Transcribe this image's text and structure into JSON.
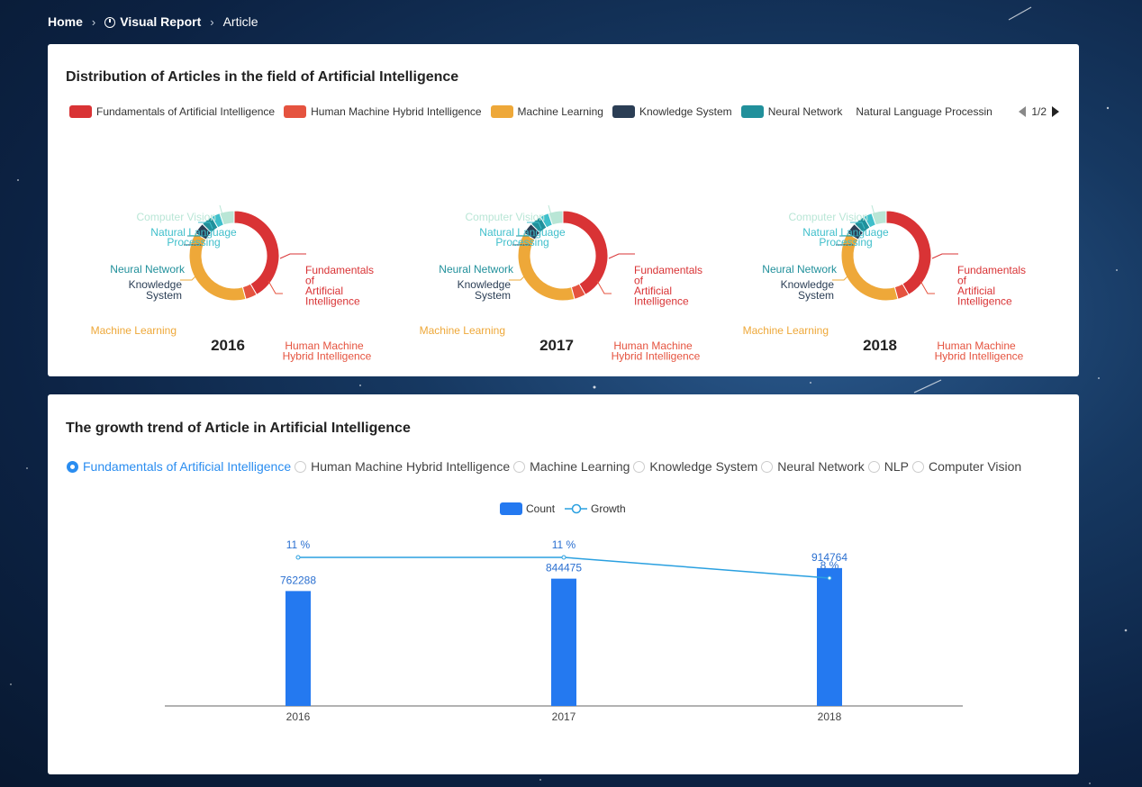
{
  "breadcrumb": {
    "home": "Home",
    "report": "Visual Report",
    "current": "Article"
  },
  "colors": {
    "fundamentals": "#d93335",
    "hmhi": "#e5533f",
    "ml": "#eea839",
    "knowledge": "#2b3e55",
    "neural": "#21909b",
    "nlp": "#3fbfcb",
    "cv": "#b9e6d6",
    "bar": "#2479f0",
    "line": "#2aa0e0"
  },
  "distribution": {
    "title": "Distribution of Articles in the field of Artificial Intelligence",
    "legend": [
      "Fundamentals of Artificial Intelligence",
      "Human Machine Hybrid Intelligence",
      "Machine Learning",
      "Knowledge System",
      "Neural Network",
      "Natural Language Processing"
    ],
    "pager": "1/2",
    "years": [
      "2016",
      "2017",
      "2018"
    ],
    "labels": {
      "cv": "Computer Vision",
      "nlp": [
        "Natural Language",
        "Processing"
      ],
      "neural": "Neural Network",
      "knowledge": [
        "Knowledge",
        "System"
      ],
      "ml": "Machine Learning",
      "fund": [
        "Fundamentals",
        "of",
        "Artificial",
        "Intelligence"
      ],
      "hmhi": [
        "Human Machine",
        "Hybrid Intelligence"
      ]
    }
  },
  "trend": {
    "title": "The growth trend of Article in Artificial Intelligence",
    "options": [
      "Fundamentals of Artificial Intelligence",
      "Human Machine Hybrid Intelligence",
      "Machine Learning",
      "Knowledge System",
      "Neural Network",
      "NLP",
      "Computer Vision"
    ],
    "selected_index": 0,
    "legend_count": "Count",
    "legend_growth": "Growth"
  },
  "chart_data": [
    {
      "type": "pie",
      "title": "2016",
      "categories": [
        "Fundamentals of Artificial Intelligence",
        "Human Machine Hybrid Intelligence",
        "Machine Learning",
        "Knowledge System",
        "Neural Network",
        "Natural Language Processing",
        "Computer Vision"
      ],
      "values": [
        40,
        4,
        36,
        4,
        4,
        3,
        5
      ]
    },
    {
      "type": "pie",
      "title": "2017",
      "categories": [
        "Fundamentals of Artificial Intelligence",
        "Human Machine Hybrid Intelligence",
        "Machine Learning",
        "Knowledge System",
        "Neural Network",
        "Natural Language Processing",
        "Computer Vision"
      ],
      "values": [
        40,
        4,
        36,
        4,
        4,
        3,
        5
      ]
    },
    {
      "type": "pie",
      "title": "2018",
      "categories": [
        "Fundamentals of Artificial Intelligence",
        "Human Machine Hybrid Intelligence",
        "Machine Learning",
        "Knowledge System",
        "Neural Network",
        "Natural Language Processing",
        "Computer Vision"
      ],
      "values": [
        40,
        4,
        36,
        4,
        4,
        3,
        5
      ]
    },
    {
      "type": "bar",
      "categories": [
        "2016",
        "2017",
        "2018"
      ],
      "series": [
        {
          "name": "Count",
          "type": "bar",
          "values": [
            762288,
            844475,
            914764
          ]
        },
        {
          "name": "Growth",
          "type": "line",
          "values": [
            11,
            11,
            8
          ],
          "unit": "%"
        }
      ]
    }
  ]
}
